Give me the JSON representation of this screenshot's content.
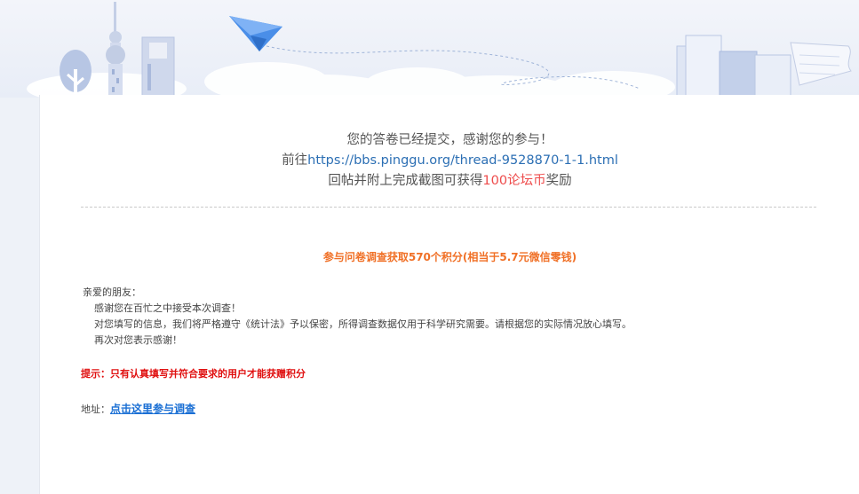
{
  "header": {
    "illustration": [
      "tree-icon",
      "tv-tower-icon",
      "skyscraper-icon",
      "paper-plane-icon",
      "cloud-icon",
      "books-icon",
      "paper-scroll-icon"
    ]
  },
  "thanks": {
    "line1": "您的答卷已经提交，感谢您的参与！",
    "line2_prefix": "前往",
    "line2_link": "https://bbs.pinggu.org/thread-9528870-1-1.html",
    "line3_before": "回帖并附上完成截图可获得",
    "line3_highlight": "100论坛币",
    "line3_after": "奖励"
  },
  "survey": {
    "points_title": "参与问卷调查获取570个积分(相当于5.7元微信零钱)",
    "greeting": "亲爱的朋友：",
    "body": [
      "感谢您在百忙之中接受本次调查！",
      "对您填写的信息，我们将严格遵守《统计法》予以保密，所得调查数据仅用于科学研究需要。请根据您的实际情况放心填写。",
      "再次对您表示感谢！"
    ],
    "tip": "提示：只有认真填写并符合要求的用户才能获赠积分",
    "address_label": "地址：",
    "address_link": "点击这里参与调查"
  },
  "colors": {
    "link": "#2c6fb4",
    "highlight": "#ee4b4b",
    "points": "#f07026",
    "tip": "#e01010",
    "address_link": "#1a6fd4"
  }
}
